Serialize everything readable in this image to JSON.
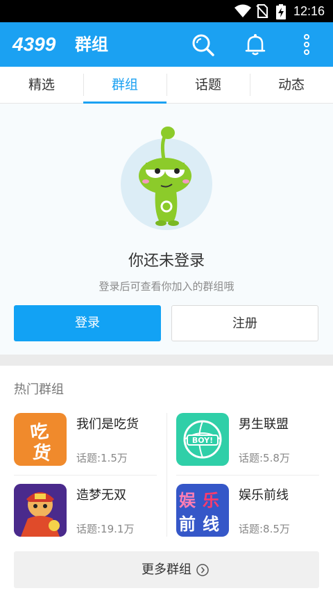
{
  "status_bar": {
    "time": "12:16"
  },
  "app_bar": {
    "brand": "4399",
    "brand_suffix": "群组"
  },
  "tabs": [
    {
      "label": "精选"
    },
    {
      "label": "群组"
    },
    {
      "label": "话题"
    },
    {
      "label": "动态"
    }
  ],
  "active_tab": "群组",
  "empty_state": {
    "title": "你还未登录",
    "subtitle": "登录后可查看你加入的群组哦",
    "login_label": "登录",
    "register_label": "注册"
  },
  "hot_groups": {
    "title": "热门群组",
    "items": [
      {
        "name": "我们是吃货",
        "count": "话题:1.5万",
        "icon": "chihuo-icon",
        "icon_text": "吃货",
        "color": "#f08a2c"
      },
      {
        "name": "男生联盟",
        "count": "话题:5.8万",
        "icon": "boy-ball-icon",
        "icon_text": "BOY!",
        "color": "#2fcfa8"
      },
      {
        "name": "造梦无双",
        "count": "话题:19.1万",
        "icon": "game-hero-icon",
        "icon_text": "",
        "color": "#6a3aa8"
      },
      {
        "name": "娱乐前线",
        "count": "话题:8.5万",
        "icon": "yule-icon",
        "icon_text": "娱乐前线",
        "color": "#3557c8"
      }
    ],
    "more_label": "更多群组"
  },
  "colors": {
    "primary": "#1ba1f2",
    "button": "#12a2f4"
  }
}
